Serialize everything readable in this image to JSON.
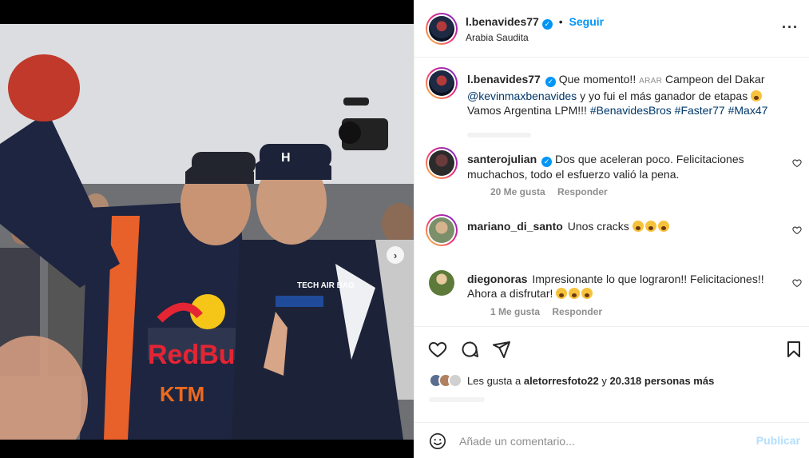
{
  "post": {
    "author": "l.benavides77",
    "verified": true,
    "follow_label": "Seguir",
    "location": "Arabia Saudita",
    "more_icon": "more-horizontal-icon"
  },
  "caption": {
    "author": "l.benavides77",
    "part1": "Que momento!!",
    "flag_text": "ARAR",
    "part2": "Campeon del Dakar",
    "mention": "@kevinmaxbenavides",
    "part3": "y yo fui el más ganador de etapas",
    "part4": "Vamos Argentina LPM!!!",
    "hashtags": [
      "#BenavidesBros",
      "#Faster77",
      "#Max47"
    ]
  },
  "comments": [
    {
      "author": "santerojulian",
      "verified": true,
      "text_line1": "Dos que aceleran poco. Felicitaciones",
      "text_line2": "muchachos, todo el esfuerzo valió la pena.",
      "likes": "20 Me gusta",
      "reply": "Responder"
    },
    {
      "author": "mariano_di_santo",
      "verified": false,
      "text_line1": "Unos cracks",
      "text_line2": "",
      "likes": "",
      "reply": ""
    },
    {
      "author": "diegonoras",
      "verified": false,
      "text_line1": "Impresionante lo que lograron!! Felicitaciones!!",
      "text_line2": "Ahora a disfrutar!",
      "likes": "1 Me gusta",
      "reply": "Responder"
    }
  ],
  "actions": {
    "like_icon": "heart-icon",
    "comment_icon": "comment-icon",
    "share_icon": "send-icon",
    "save_icon": "bookmark-icon"
  },
  "likes": {
    "prefix": "Les gusta a",
    "user": "aletorresfoto22",
    "middle": "y",
    "count": "20.318 personas más"
  },
  "composer": {
    "placeholder": "Añade un comentario...",
    "post_label": "Publicar",
    "emoji_icon": "smiley-icon"
  },
  "carousel": {
    "total": 2,
    "active": 1,
    "next_icon": "chevron-right-icon"
  },
  "colors": {
    "accent": "#0095f6",
    "link": "#00376b",
    "muted": "#8e8e8e",
    "publish_disabled": "#b2dffc"
  }
}
